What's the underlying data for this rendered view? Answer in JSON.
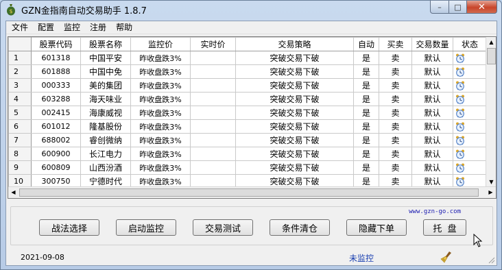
{
  "window": {
    "title": "GZN金指南自动交易助手 1.8.7",
    "minimize_glyph": "–",
    "maximize_glyph": "□",
    "close_glyph": "✕"
  },
  "menu": [
    "文件",
    "配置",
    "监控",
    "注册",
    "帮助"
  ],
  "grid": {
    "columns": [
      "",
      "股票代码",
      "股票名称",
      "监控价",
      "实时价",
      "交易策略",
      "自动",
      "买卖",
      "交易数量",
      "状态"
    ],
    "rows": [
      {
        "n": "1",
        "code": "601318",
        "name": "中国平安",
        "monitor": "昨收盘跌3%",
        "realtime": "",
        "strategy": "突破交易下破",
        "auto": "是",
        "side": "卖",
        "qty": "默认",
        "status": "alarm-clock-icon"
      },
      {
        "n": "2",
        "code": "601888",
        "name": "中国中免",
        "monitor": "昨收盘跌3%",
        "realtime": "",
        "strategy": "突破交易下破",
        "auto": "是",
        "side": "卖",
        "qty": "默认",
        "status": "alarm-clock-icon"
      },
      {
        "n": "3",
        "code": "000333",
        "name": "美的集团",
        "monitor": "昨收盘跌3%",
        "realtime": "",
        "strategy": "突破交易下破",
        "auto": "是",
        "side": "卖",
        "qty": "默认",
        "status": "alarm-clock-icon"
      },
      {
        "n": "4",
        "code": "603288",
        "name": "海天味业",
        "monitor": "昨收盘跌3%",
        "realtime": "",
        "strategy": "突破交易下破",
        "auto": "是",
        "side": "卖",
        "qty": "默认",
        "status": "alarm-clock-icon"
      },
      {
        "n": "5",
        "code": "002415",
        "name": "海康威视",
        "monitor": "昨收盘跌3%",
        "realtime": "",
        "strategy": "突破交易下破",
        "auto": "是",
        "side": "卖",
        "qty": "默认",
        "status": "alarm-clock-icon"
      },
      {
        "n": "6",
        "code": "601012",
        "name": "隆基股份",
        "monitor": "昨收盘跌3%",
        "realtime": "",
        "strategy": "突破交易下破",
        "auto": "是",
        "side": "卖",
        "qty": "默认",
        "status": "alarm-clock-icon"
      },
      {
        "n": "7",
        "code": "688002",
        "name": "睿创微纳",
        "monitor": "昨收盘跌3%",
        "realtime": "",
        "strategy": "突破交易下破",
        "auto": "是",
        "side": "卖",
        "qty": "默认",
        "status": "alarm-clock-icon"
      },
      {
        "n": "8",
        "code": "600900",
        "name": "长江电力",
        "monitor": "昨收盘跌3%",
        "realtime": "",
        "strategy": "突破交易下破",
        "auto": "是",
        "side": "卖",
        "qty": "默认",
        "status": "alarm-clock-icon"
      },
      {
        "n": "9",
        "code": "600809",
        "name": "山西汾酒",
        "monitor": "昨收盘跌3%",
        "realtime": "",
        "strategy": "突破交易下破",
        "auto": "是",
        "side": "卖",
        "qty": "默认",
        "status": "alarm-clock-icon"
      },
      {
        "n": "10",
        "code": "300750",
        "name": "宁德时代",
        "monitor": "昨收盘跌3%",
        "realtime": "",
        "strategy": "突破交易下破",
        "auto": "是",
        "side": "卖",
        "qty": "默认",
        "status": "alarm-clock-icon"
      }
    ]
  },
  "panel": {
    "site": "www.gzn-go.com",
    "buttons": [
      "战法选择",
      "启动监控",
      "交易测试",
      "条件清仓",
      "隐藏下单",
      "托  盘"
    ]
  },
  "status": {
    "date": "2021-09-08",
    "monitor_state": "未监控",
    "tray_icon": "broom-icon"
  },
  "colors": {
    "close_button": "#c8452a",
    "link": "#1a1ab0",
    "monitor_state": "#1a3fb0"
  }
}
